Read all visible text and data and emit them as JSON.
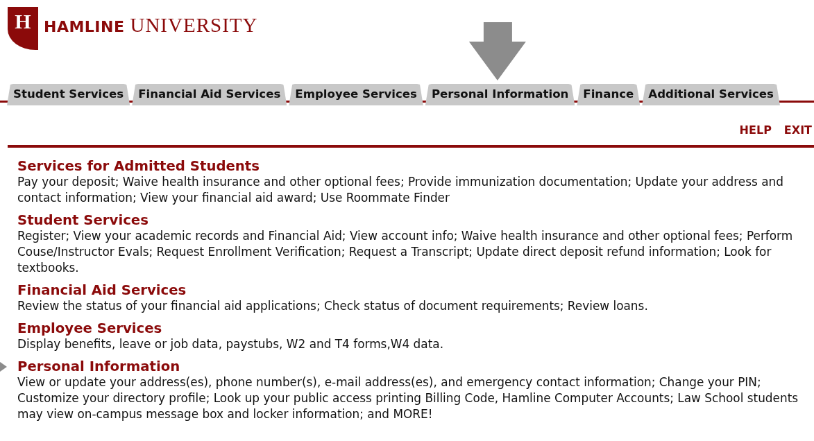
{
  "logo": {
    "letter": "H",
    "name_bold": "HAMLINE",
    "name_serif": "UNIVERSITY"
  },
  "tabs": [
    {
      "label": "Student Services",
      "pointed": false
    },
    {
      "label": "Financial Aid Services",
      "pointed": false
    },
    {
      "label": "Employee Services",
      "pointed": false
    },
    {
      "label": "Personal Information",
      "pointed": true
    },
    {
      "label": "Finance",
      "pointed": false
    },
    {
      "label": "Additional Services",
      "pointed": false
    }
  ],
  "links": [
    "HELP",
    "EXIT"
  ],
  "sections": [
    {
      "title": "Services for Admitted Students",
      "description": "Pay your deposit; Waive health insurance and other optional fees; Provide immunization documentation; Update your address and contact information; View your financial aid award; Use Roommate Finder",
      "pointed": false
    },
    {
      "title": "Student Services",
      "description": "Register; View your academic records and Financial Aid; View account info; Waive health insurance and other optional fees; Perform Couse/Instructor Evals; Request Enrollment Verification; Request a Transcript; Update direct deposit refund information; Look for textbooks.",
      "pointed": false
    },
    {
      "title": "Financial Aid Services",
      "description": "Review the status of your financial aid applications; Check status of document requirements; Review loans.",
      "pointed": false
    },
    {
      "title": "Employee Services",
      "description": "Display benefits, leave or job data, paystubs, W2 and T4 forms,W4 data.",
      "pointed": false
    },
    {
      "title": "Personal Information",
      "description": "View or update your address(es), phone number(s), e-mail address(es), and emergency contact information; Change your PIN; Customize your directory profile; Look up your public access printing Billing Code, Hamline Computer Accounts; Law School students may view on-campus message box and locker information; and MORE!",
      "pointed": true
    }
  ]
}
